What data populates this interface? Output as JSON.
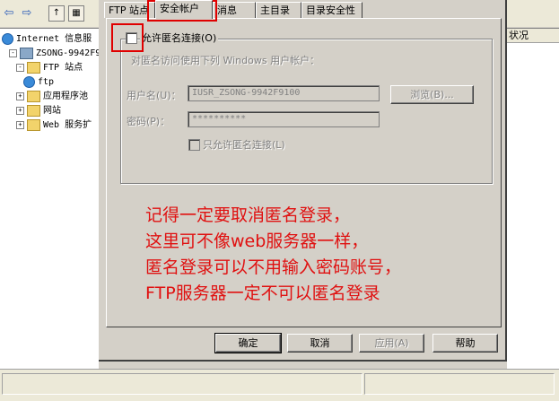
{
  "iis": {
    "toolbar": {
      "back_icon": "back-arrow-icon",
      "forward_icon": "forward-arrow-icon"
    },
    "tree": [
      {
        "label": "Internet 信息服",
        "indent": 0,
        "icon": "globe",
        "expander": ""
      },
      {
        "label": "ZSONG-9942F9",
        "indent": 1,
        "icon": "pc",
        "expander": "-"
      },
      {
        "label": "FTP 站点",
        "indent": 2,
        "icon": "folder",
        "expander": "-"
      },
      {
        "label": "ftp",
        "indent": 3,
        "icon": "globe",
        "expander": ""
      },
      {
        "label": "应用程序池",
        "indent": 2,
        "icon": "folder",
        "expander": "+"
      },
      {
        "label": "网站",
        "indent": 2,
        "icon": "folder",
        "expander": "+"
      },
      {
        "label": "Web 服务扩",
        "indent": 2,
        "icon": "folder",
        "expander": "+"
      }
    ],
    "right_header": "状况"
  },
  "dialog": {
    "tabs": [
      "FTP 站点",
      "安全帐户",
      "消息",
      "主目录",
      "目录安全性"
    ],
    "active_tab": "安全帐户",
    "allow_anonymous": {
      "label": "允许匿名连接(O)",
      "checked": false
    },
    "anon_hint": "对匿名访问使用下列 Windows 用户帐户：",
    "username": {
      "label": "用户名(U)：",
      "value": "IUSR_ZSONG-9942F9100"
    },
    "browse_button": "浏览(B)...",
    "password": {
      "label": "密码(P)：",
      "value": "**********"
    },
    "only_anonymous": {
      "label": "只允许匿名连接(L)",
      "checked": false
    },
    "buttons": {
      "ok": "确定",
      "cancel": "取消",
      "apply": "应用(A)",
      "help": "帮助"
    }
  },
  "annotation": {
    "color": "#e01010",
    "lines": [
      "记得一定要取消匿名登录，",
      "这里可不像web服务器一样，",
      "匿名登录可以不用输入密码账号，",
      "FTP服务器一定不可以匿名登录"
    ]
  }
}
